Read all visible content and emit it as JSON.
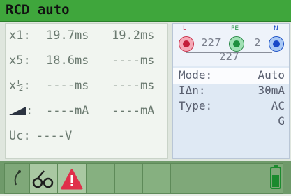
{
  "title": "RCD auto",
  "readings": [
    {
      "label": "x1:",
      "value1": "19.7ms",
      "value2": "19.2ms"
    },
    {
      "label": "x5:",
      "value1": "18.6ms",
      "value2": "----ms"
    },
    {
      "label": "x½:",
      "value1": "----ms",
      "value2": "----ms"
    },
    {
      "label": ":",
      "value1": "----mA",
      "value2": "----mA"
    },
    {
      "label": "Uc:",
      "value1": "----V",
      "value2": ""
    }
  ],
  "connections": {
    "terminal_labels": {
      "l": "L",
      "pe": "PE",
      "n": "N"
    },
    "l_pe": "227",
    "pe_n": "2",
    "l_n": "227"
  },
  "params": {
    "mode": {
      "label": "Mode:",
      "value": "Auto"
    },
    "idn": {
      "label": "IΔn:",
      "value": "30mA"
    },
    "type": {
      "label": "Type:",
      "value": "AC",
      "value2": "G"
    }
  },
  "toolbar": {
    "icons": [
      "probe-icon",
      "open-circuit-icon",
      "warning-icon",
      "battery-icon"
    ]
  },
  "colors": {
    "title_bar": "#3fa63c",
    "toolbar": "#6f9a6a",
    "warning": "#e0304a",
    "battery": "#1b8a2e"
  }
}
